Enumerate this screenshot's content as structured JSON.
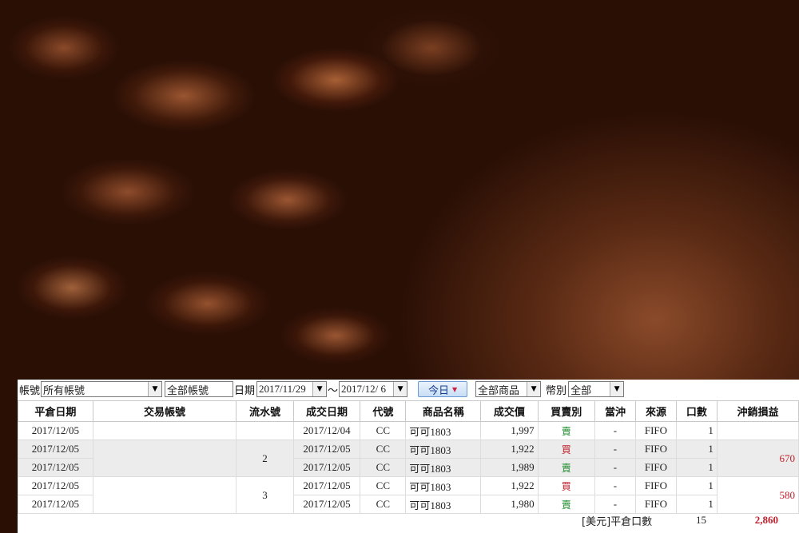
{
  "filters": {
    "account_label": "帳號",
    "account_value": "所有帳號",
    "account_type_value": "全部帳號",
    "date_label": "日期",
    "date_from": "2017/11/29",
    "date_sep": "～",
    "date_to": "2017/12/ 6",
    "today_label": "今日",
    "product_value": "全部商品",
    "currency_label": "幣別",
    "currency_value": "全部"
  },
  "table": {
    "headers": [
      "平倉日期",
      "交易帳號",
      "流水號",
      "成交日期",
      "代號",
      "商品名稱",
      "成交價",
      "買賣別",
      "當沖",
      "來源",
      "口數",
      "沖銷損益"
    ],
    "rows": [
      {
        "close_date": "2017/12/05",
        "account": "",
        "serial": "",
        "trade_date": "2017/12/04",
        "code": "CC",
        "name": "可可1803",
        "price": "1,997",
        "side": "賣",
        "daytrade": "-",
        "source": "FIFO",
        "qty": "1",
        "pnl": ""
      },
      {
        "close_date": "2017/12/05",
        "account": "",
        "serial": "2",
        "trade_date": "2017/12/05",
        "code": "CC",
        "name": "可可1803",
        "price": "1,922",
        "side": "買",
        "daytrade": "-",
        "source": "FIFO",
        "qty": "1",
        "pnl": "670"
      },
      {
        "close_date": "2017/12/05",
        "account": "",
        "serial": "",
        "trade_date": "2017/12/05",
        "code": "CC",
        "name": "可可1803",
        "price": "1,989",
        "side": "賣",
        "daytrade": "-",
        "source": "FIFO",
        "qty": "1",
        "pnl": ""
      },
      {
        "close_date": "2017/12/05",
        "account": "",
        "serial": "3",
        "trade_date": "2017/12/05",
        "code": "CC",
        "name": "可可1803",
        "price": "1,922",
        "side": "買",
        "daytrade": "-",
        "source": "FIFO",
        "qty": "1",
        "pnl": "580"
      },
      {
        "close_date": "2017/12/05",
        "account": "",
        "serial": "",
        "trade_date": "2017/12/05",
        "code": "CC",
        "name": "可可1803",
        "price": "1,980",
        "side": "賣",
        "daytrade": "-",
        "source": "FIFO",
        "qty": "1",
        "pnl": ""
      }
    ]
  },
  "footer": {
    "label": "[美元]平倉口數",
    "qty_total": "15",
    "pnl_total": "2,860"
  },
  "colors": {
    "buy": "#c0202c",
    "sell": "#1a8a2a",
    "pnl_positive": "#c0202c"
  }
}
